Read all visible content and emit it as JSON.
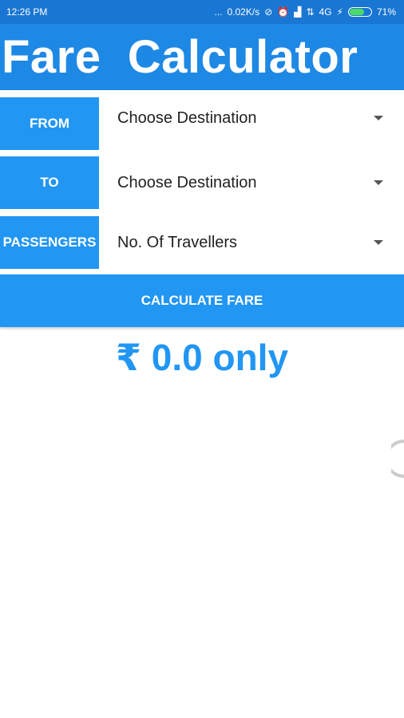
{
  "status_bar": {
    "time": "12:26 PM",
    "dots": "...",
    "speed": "0.02K/s",
    "network": "4G",
    "battery": "71%",
    "battery_level": 0.71,
    "icons": [
      "sync-off-icon",
      "alarm-icon",
      "signal-icon",
      "data-arrows-icon",
      "charging-icon",
      "battery-icon"
    ]
  },
  "header": {
    "title": "Fare  Calculator"
  },
  "form": {
    "from_label": "FROM",
    "to_label": "TO",
    "passengers_label": "PASSENGERS",
    "from_value": "Choose Destination",
    "to_value": "Choose Destination",
    "passengers_value": "No. Of Travellers"
  },
  "calculate_button": "CALCULATE FARE",
  "result": "₹ 0.0 only",
  "colors": {
    "status_bar": "#1976D2",
    "header": "#1E88E5",
    "accent": "#2196F3",
    "battery": "#4CD964"
  }
}
